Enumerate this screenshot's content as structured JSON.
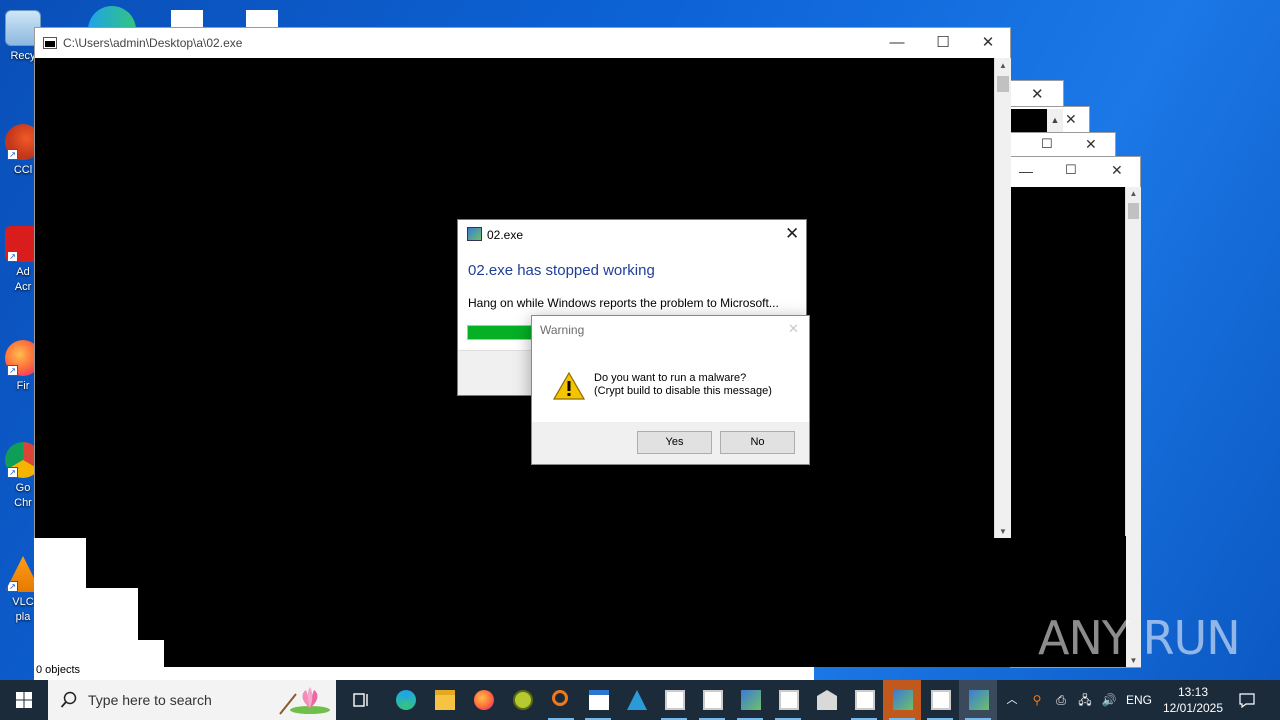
{
  "desktop": {
    "icons": [
      {
        "label": "Recy",
        "name": "recycle-bin-icon"
      },
      {
        "label": "CCl",
        "name": "ccleaner-icon"
      },
      {
        "label": "Ad\nAcr",
        "name": "adobe-acrobat-icon"
      },
      {
        "label": "Fir",
        "name": "firefox-icon"
      },
      {
        "label": "Go\nChr",
        "name": "google-chrome-icon"
      },
      {
        "label": "VLC\npla",
        "name": "vlc-player-icon"
      }
    ]
  },
  "main_window": {
    "title": "C:\\Users\\admin\\Desktop\\a\\02.exe",
    "status": "0 objects"
  },
  "error_dialog": {
    "title": "02.exe",
    "heading": "02.exe has stopped working",
    "message": "Hang on while Windows reports the problem to Microsoft...",
    "progress": 0.22,
    "progress_color": "#06b025",
    "heading_color": "#1e3f9a"
  },
  "warning_dialog": {
    "title": "Warning",
    "line1": "Do you want to run a malware?",
    "line2": "(Crypt build to disable this message)",
    "yes_label": "Yes",
    "no_label": "No"
  },
  "taskbar": {
    "search_placeholder": "Type here to search",
    "language": "ENG",
    "time": "13:13",
    "date": "12/01/2025"
  },
  "watermark": "ANY RUN"
}
